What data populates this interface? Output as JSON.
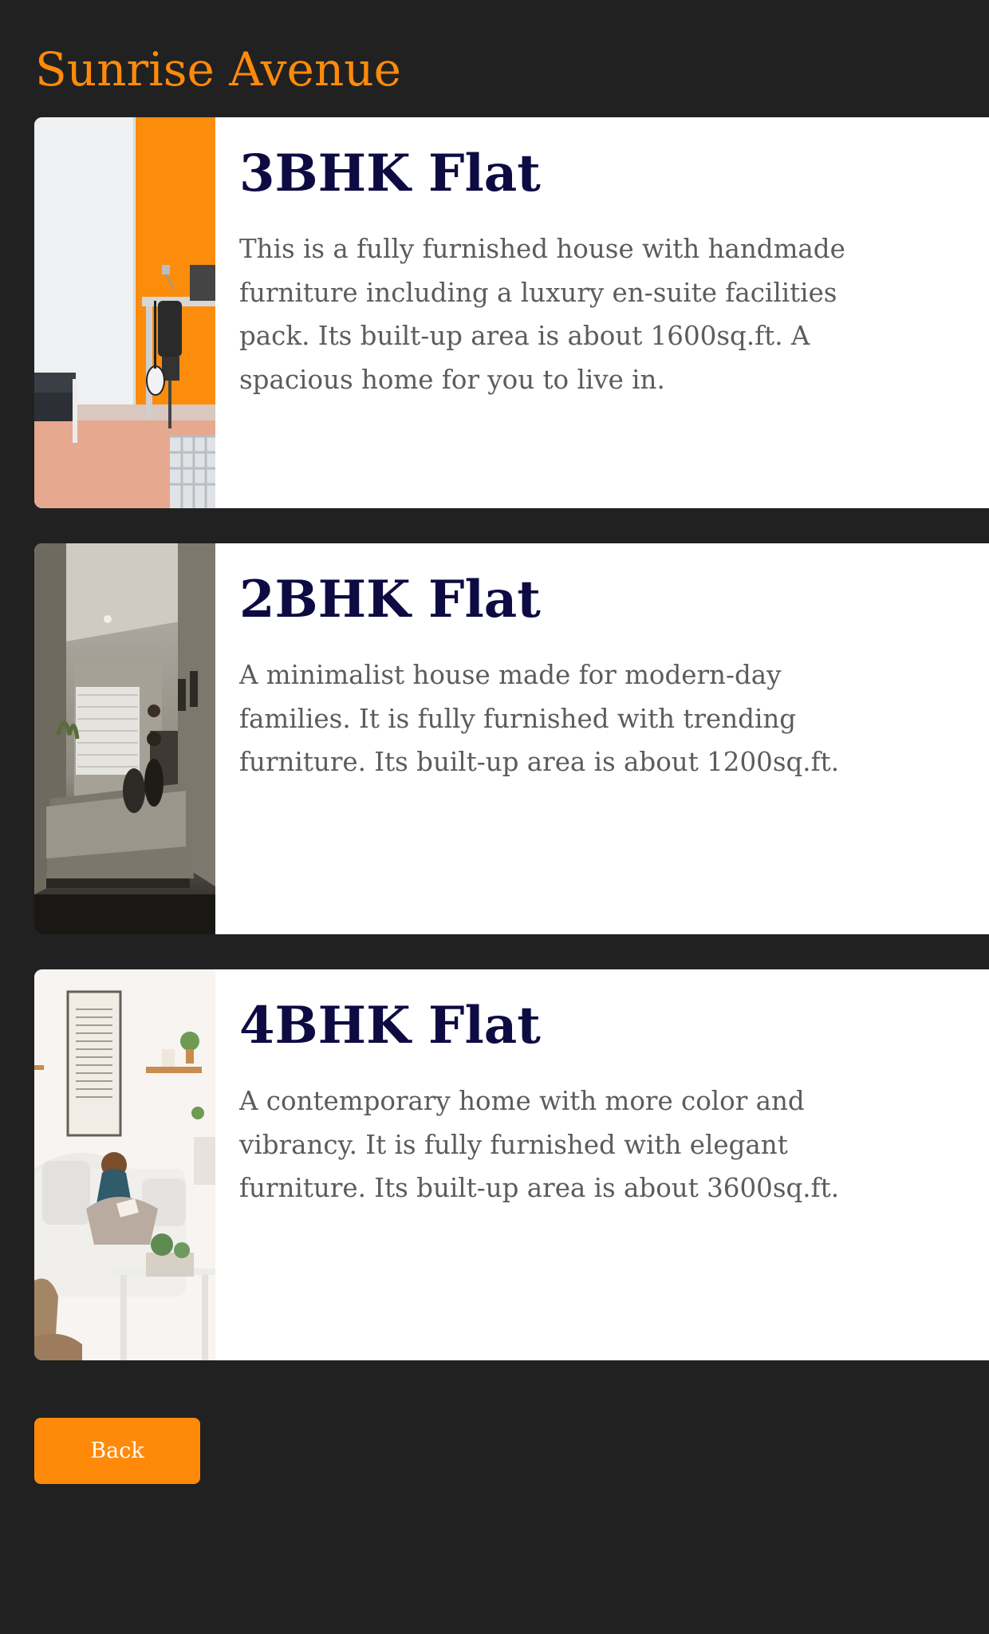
{
  "header": {
    "title": "Sunrise Avenue"
  },
  "listings": [
    {
      "title": "3BHK Flat",
      "description": "This is a fully furnished house with handmade furniture including a luxury en-suite facilities pack. Its built-up area is about 1600sq.ft. A spacious home for you to live in.",
      "image_icon": "room-photo-orange-wall"
    },
    {
      "title": "2BHK Flat",
      "description": "A minimalist house made for modern-day families. It is fully furnished with trending furniture. Its built-up area is about 1200sq.ft.",
      "image_icon": "room-photo-bedroom"
    },
    {
      "title": "4BHK Flat",
      "description": "A contemporary home with more color and vibrancy. It is fully furnished with elegant furniture. Its built-up area is about 3600sq.ft.",
      "image_icon": "room-photo-living-room"
    }
  ],
  "actions": {
    "back_label": "Back"
  },
  "colors": {
    "background": "#212121",
    "accent": "#ff8a0a",
    "card_title": "#0e0b43",
    "card_text": "#5c5c5c"
  }
}
